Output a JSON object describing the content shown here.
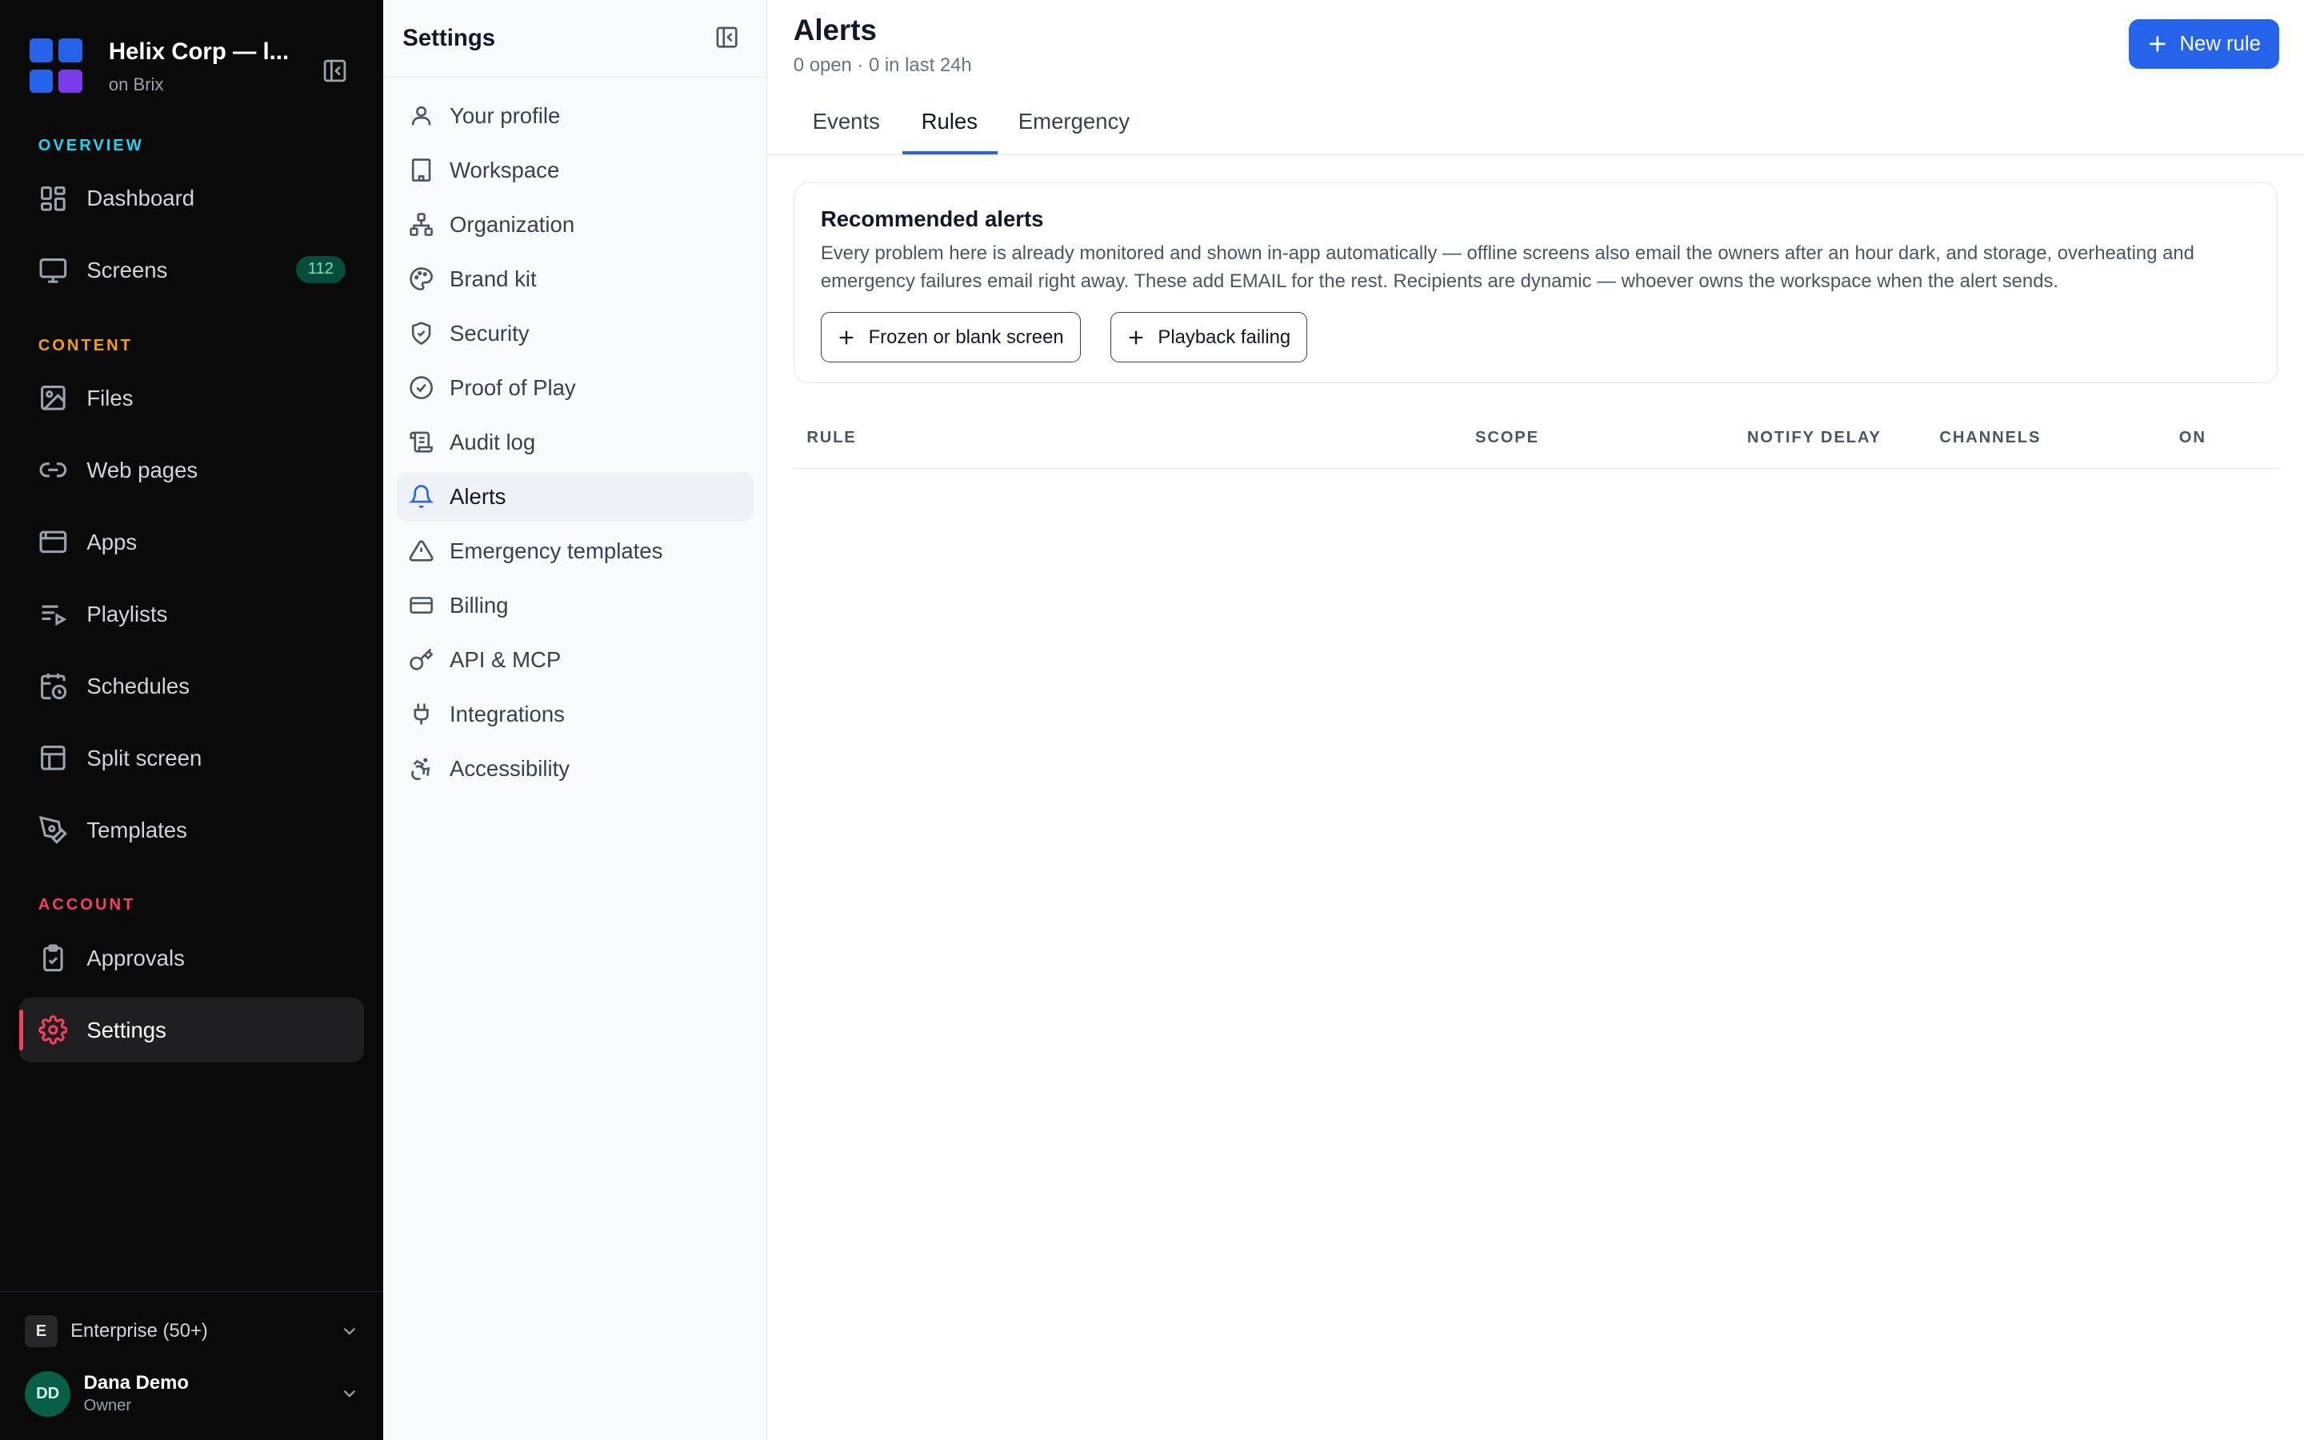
{
  "workspace": {
    "name": "Helix Corp — l...",
    "subtitle": "on Brix",
    "logo_colors": [
      "#2563eb",
      "#2563eb",
      "#2563eb",
      "#7c3aed"
    ]
  },
  "sidebar": {
    "sections": [
      {
        "label": "OVERVIEW",
        "color": "#22d3ee"
      },
      {
        "label": "CONTENT",
        "color": "#f59e0b"
      },
      {
        "label": "ACCOUNT",
        "color": "#f43f5e"
      }
    ],
    "items": [
      {
        "label": "Dashboard",
        "icon": "dashboard-icon"
      },
      {
        "label": "Screens",
        "icon": "monitor-icon",
        "badge": "112"
      },
      {
        "label": "Files",
        "icon": "image-icon"
      },
      {
        "label": "Web pages",
        "icon": "link-icon"
      },
      {
        "label": "Apps",
        "icon": "app-window-icon"
      },
      {
        "label": "Playlists",
        "icon": "playlist-icon"
      },
      {
        "label": "Schedules",
        "icon": "calendar-clock-icon"
      },
      {
        "label": "Split screen",
        "icon": "layout-icon"
      },
      {
        "label": "Templates",
        "icon": "pen-tool-icon"
      },
      {
        "label": "Approvals",
        "icon": "clipboard-check-icon"
      },
      {
        "label": "Settings",
        "icon": "gear-icon",
        "active": true
      }
    ],
    "plan": {
      "chip": "E",
      "label": "Enterprise (50+)"
    },
    "user": {
      "initials": "DD",
      "name": "Dana Demo",
      "role": "Owner"
    }
  },
  "settings": {
    "title": "Settings",
    "items": [
      {
        "label": "Your profile",
        "icon": "user-icon"
      },
      {
        "label": "Workspace",
        "icon": "building-icon"
      },
      {
        "label": "Organization",
        "icon": "org-chart-icon"
      },
      {
        "label": "Brand kit",
        "icon": "palette-icon"
      },
      {
        "label": "Security",
        "icon": "shield-icon"
      },
      {
        "label": "Proof of Play",
        "icon": "check-circle-icon"
      },
      {
        "label": "Audit log",
        "icon": "scroll-icon"
      },
      {
        "label": "Alerts",
        "icon": "bell-icon",
        "active": true
      },
      {
        "label": "Emergency templates",
        "icon": "warning-icon"
      },
      {
        "label": "Billing",
        "icon": "credit-card-icon"
      },
      {
        "label": "API & MCP",
        "icon": "key-icon"
      },
      {
        "label": "Integrations",
        "icon": "plug-icon"
      },
      {
        "label": "Accessibility",
        "icon": "accessibility-icon"
      }
    ]
  },
  "main": {
    "title": "Alerts",
    "subtitle": "0 open · 0 in last 24h",
    "new_rule_label": "New rule",
    "tabs": [
      {
        "label": "Events"
      },
      {
        "label": "Rules",
        "active": true
      },
      {
        "label": "Emergency"
      }
    ],
    "recommended": {
      "title": "Recommended alerts",
      "description": "Every problem here is already monitored and shown in-app automatically — offline screens also email the owners after an hour dark, and storage, overheating and emergency failures email right away. These add EMAIL for the rest. Recipients are dynamic — whoever owns the workspace when the alert sends.",
      "buttons": [
        {
          "label": "Frozen or blank screen"
        },
        {
          "label": "Playback failing"
        }
      ]
    },
    "table": {
      "columns": [
        "RULE",
        "SCOPE",
        "NOTIFY DELAY",
        "CHANNELS",
        "ON"
      ]
    }
  },
  "colors": {
    "accent": "#2563eb",
    "sidebar_bg": "#0a0a0b",
    "active_marker": "#f43f5e",
    "badge_bg": "#064e3b",
    "badge_text": "#6ee7b7"
  }
}
